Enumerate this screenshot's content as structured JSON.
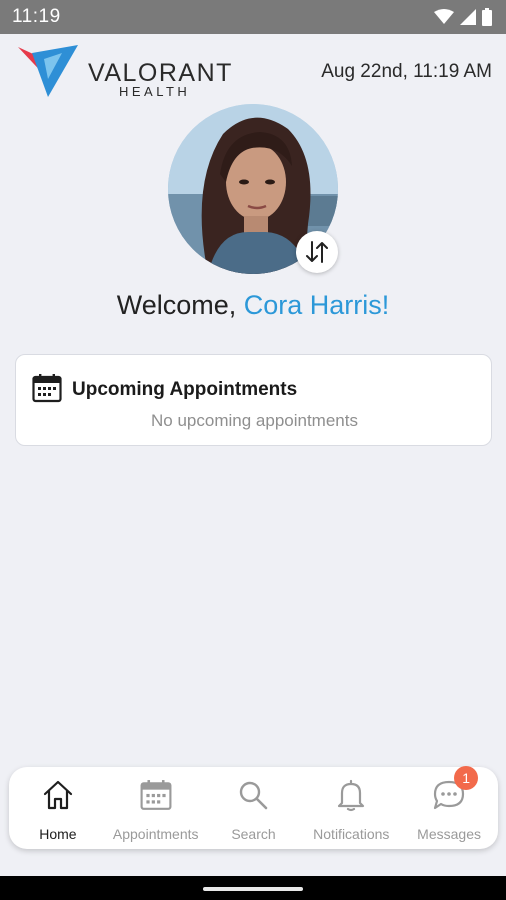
{
  "status_bar": {
    "time": "11:19",
    "icons": [
      "wifi-icon",
      "cellular-icon",
      "battery-icon"
    ]
  },
  "header": {
    "brand_name": "VALORANT",
    "brand_sub": "HEALTH",
    "datetime": "Aug 22nd, 11:19 AM"
  },
  "profile": {
    "welcome_prefix": "Welcome, ",
    "user_name": "Cora Harris!",
    "switch_icon": "swap-vertical-icon"
  },
  "appointments_card": {
    "title": "Upcoming Appointments",
    "empty_text": "No upcoming appointments",
    "icon": "calendar-icon"
  },
  "bottom_nav": {
    "items": [
      {
        "label": "Home",
        "icon": "home-icon",
        "active": true
      },
      {
        "label": "Appointments",
        "icon": "calendar-icon",
        "active": false
      },
      {
        "label": "Search",
        "icon": "search-icon",
        "active": false
      },
      {
        "label": "Notifications",
        "icon": "bell-icon",
        "active": false
      },
      {
        "label": "Messages",
        "icon": "chat-icon",
        "active": false,
        "badge": "1"
      }
    ]
  },
  "colors": {
    "accent": "#2c98d8",
    "badge": "#f26a4b",
    "background": "#eff0f5",
    "status_bar": "#7a7a7a"
  }
}
